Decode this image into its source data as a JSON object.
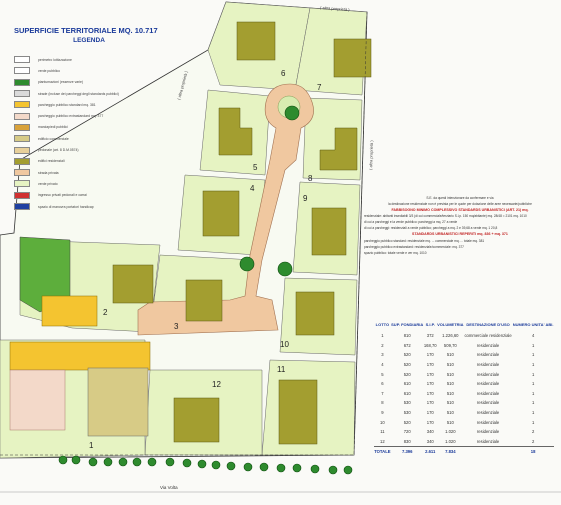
{
  "header": {
    "title": "SUPERFICIE TERRITORIALE MQ. 10.717",
    "legend_title": "LEGENDA"
  },
  "legend": [
    {
      "label": "perimetro lottizzazione",
      "color": "#ffffff"
    },
    {
      "label": "verde pubblico",
      "color": "#ffffff"
    },
    {
      "label": "piantumazioni (essenze varie)",
      "color": "#2e8b2e"
    },
    {
      "label": "strade (incluse dei parcheggi degli standards pubblici)",
      "color": "#dadada"
    },
    {
      "label": "parcheggio pubblico standard mq. 381",
      "color": "#f4c430"
    },
    {
      "label": "parcheggio pubblico extrastandard mq. 377",
      "color": "#f3d9c9"
    },
    {
      "label": "marciapiedi pubblici",
      "color": "#d9a23a"
    },
    {
      "label": "edificio commerciale",
      "color": "#d7cb86"
    },
    {
      "label": "pedonale (art. 8 D.M.0574)",
      "color": "#e8d09a"
    },
    {
      "label": "edifici residenziali",
      "color": "#a39e30"
    },
    {
      "label": "strada privata",
      "color": "#f0c8a0"
    },
    {
      "label": "verde privato",
      "color": "#e6f3c2"
    },
    {
      "label": "ingresso privati pedonali e carrai",
      "color": "#d03030"
    },
    {
      "label": "spazio di manovra portatori handicap",
      "color": "#2040a0"
    }
  ],
  "lot_labels": [
    "6",
    "7",
    "5",
    "8",
    "4",
    "9",
    "2",
    "3",
    "10",
    "11",
    "12",
    "1"
  ],
  "street_labels": {
    "north": "( altra proprietà )",
    "west": "( altra proprietà )",
    "east": "( altra proprietà )",
    "south": "Via Volta"
  },
  "notes": [
    "S.E. da questi intenzionare da confermare e via",
    "la destinazione residenziale non è prevista per le quote per dotazione delle aree necessarie/pubbliche",
    "FABBISOGNO MINIMO COMPLESSIVO STANDARDS URBANISTICI (ART. 21) mq.",
    "residenziale: abitanti insediabili 3/3 (di cui commerciale/terziario S.l.p. 150 mq/abitante) mq. 28/48 = 2101 mq. 1010",
    "di cui a parcheggi e la verde pubblico: parcheggi a mq. 27 a verde",
    "di cui a parcheggi: residenziali a verde pubblico; parcheggi a mq. 2 e 39,68 a verde mq. 1 20,8",
    "STANDARDS URBANISTICI REPERITI mq. 836 + mq. 371",
    "parcheggio pubblico standard: residenziale mq. ... commerciale mq. ... totale mq. 381",
    "parcheggio pubblico extrastandard: residenziale/commerciale: mq. 377",
    "spazio pubblico: totale verde e ver mq. 1010"
  ],
  "table": {
    "headers": [
      "LOTTO",
      "SUP. FONDIARIA",
      "S.l.P.",
      "VOLUMETRIA",
      "DESTINAZIONE D'USO",
      "NUMERO UNITA' ABI."
    ],
    "rows": [
      [
        "1",
        "810",
        "372",
        "1.226,60",
        "commerciale residenziale",
        "4"
      ],
      [
        "2",
        "672",
        "168,70",
        "509,70",
        "residenziale",
        "1"
      ],
      [
        "3",
        "520",
        "170",
        "510",
        "residenziale",
        "1"
      ],
      [
        "4",
        "520",
        "170",
        "510",
        "residenziale",
        "1"
      ],
      [
        "5",
        "520",
        "170",
        "510",
        "residenziale",
        "1"
      ],
      [
        "6",
        "610",
        "170",
        "510",
        "residenziale",
        "1"
      ],
      [
        "7",
        "610",
        "170",
        "510",
        "residenziale",
        "1"
      ],
      [
        "8",
        "530",
        "170",
        "510",
        "residenziale",
        "1"
      ],
      [
        "9",
        "530",
        "170",
        "510",
        "residenziale",
        "1"
      ],
      [
        "10",
        "520",
        "170",
        "510",
        "residenziale",
        "1"
      ],
      [
        "11",
        "720",
        "340",
        "1.020",
        "residenziale",
        "2"
      ],
      [
        "12",
        "830",
        "340",
        "1.020",
        "residenziale",
        "2"
      ]
    ],
    "total": [
      "TOTALE",
      "7.396",
      "2.611",
      "7.834",
      "",
      "18"
    ]
  },
  "colors": {
    "lot_green": "#e6f3c2",
    "building": "#a39e30",
    "road": "#f0c8a0",
    "parking": "#f4c430",
    "trees": "#2e8b2e",
    "ink": "#1a3a9a"
  }
}
